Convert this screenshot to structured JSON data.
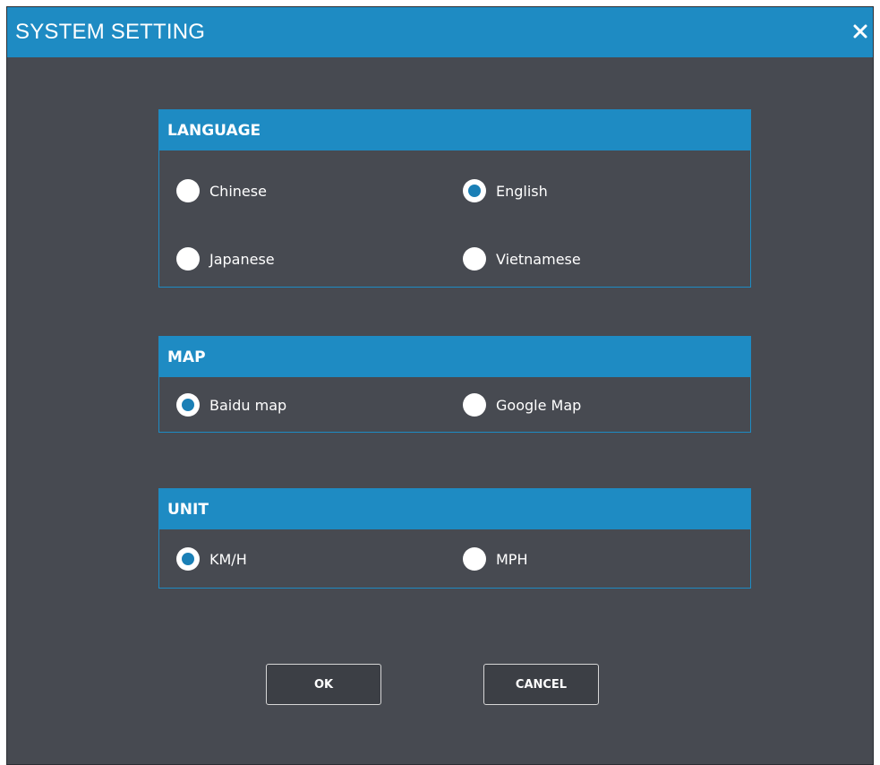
{
  "window": {
    "title": "SYSTEM SETTING",
    "close_icon": "close-icon"
  },
  "language": {
    "header": "LANGUAGE",
    "options": [
      {
        "label": "Chinese",
        "checked": false
      },
      {
        "label": "English",
        "checked": true
      },
      {
        "label": "Japanese",
        "checked": false
      },
      {
        "label": "Vietnamese",
        "checked": false
      }
    ]
  },
  "map": {
    "header": "MAP",
    "options": [
      {
        "label": "Baidu map",
        "checked": true
      },
      {
        "label": "Google Map",
        "checked": false
      }
    ]
  },
  "unit": {
    "header": "UNIT",
    "options": [
      {
        "label": "KM/H",
        "checked": true
      },
      {
        "label": "MPH",
        "checked": false
      }
    ]
  },
  "buttons": {
    "ok": "OK",
    "cancel": "CANCEL"
  },
  "colors": {
    "accent": "#1e8bc3",
    "background": "#474a51",
    "radio_fill": "#1a7fb6"
  }
}
